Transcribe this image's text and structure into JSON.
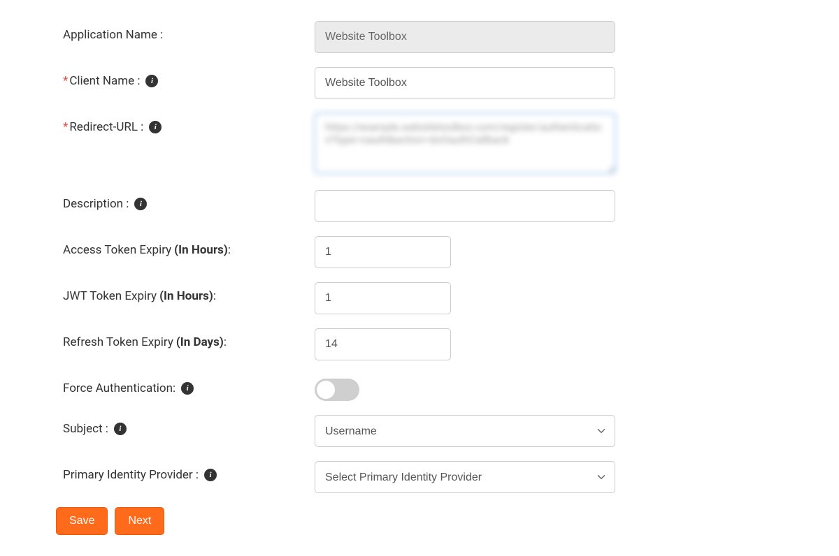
{
  "form": {
    "application_name": {
      "label": "Application Name :",
      "value": "Website Toolbox"
    },
    "client_name": {
      "label": "Client Name :",
      "value": "Website Toolbox"
    },
    "redirect_url": {
      "label": "Redirect-URL :",
      "value": "https://example.websitetoolbox.com/register/authentication?type=oauth&action=doOauthCallback"
    },
    "description": {
      "label": "Description :",
      "value": ""
    },
    "access_token_expiry": {
      "label": "Access Token Expiry",
      "unit": "(In Hours)",
      "colon": ":",
      "value": "1"
    },
    "jwt_token_expiry": {
      "label": "JWT Token Expiry",
      "unit": "(In Hours)",
      "colon": ":",
      "value": "1"
    },
    "refresh_token_expiry": {
      "label": "Refresh Token Expiry",
      "unit": "(In Days)",
      "colon": ":",
      "value": "14"
    },
    "force_authentication": {
      "label": "Force Authentication:",
      "enabled": false
    },
    "subject": {
      "label": "Subject :",
      "value": "Username"
    },
    "primary_idp": {
      "label": "Primary Identity Provider :",
      "value": "Select Primary Identity Provider"
    }
  },
  "buttons": {
    "save": "Save",
    "next": "Next"
  },
  "icons": {
    "info": "i"
  }
}
